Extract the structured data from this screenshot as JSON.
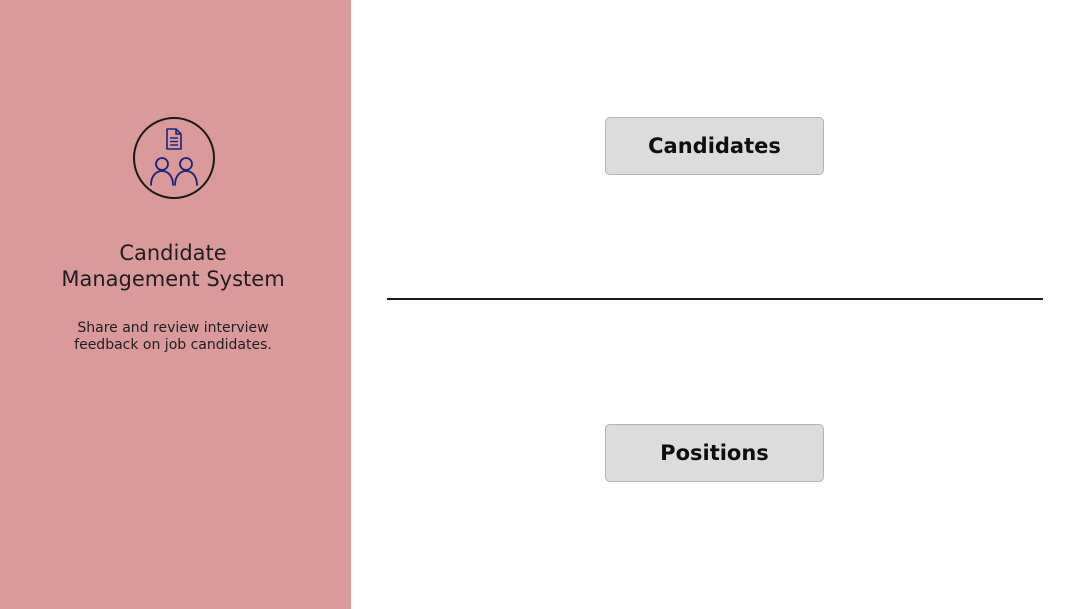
{
  "sidebar": {
    "logo_icon": "document-people-icon",
    "title": "Candidate\nManagement System",
    "subtitle": "Share and review interview\nfeedback on job candidates.",
    "background_color": "#db9a9a",
    "icon_color": "#1a237e"
  },
  "main": {
    "candidates_label": "Candidates",
    "positions_label": "Positions"
  }
}
